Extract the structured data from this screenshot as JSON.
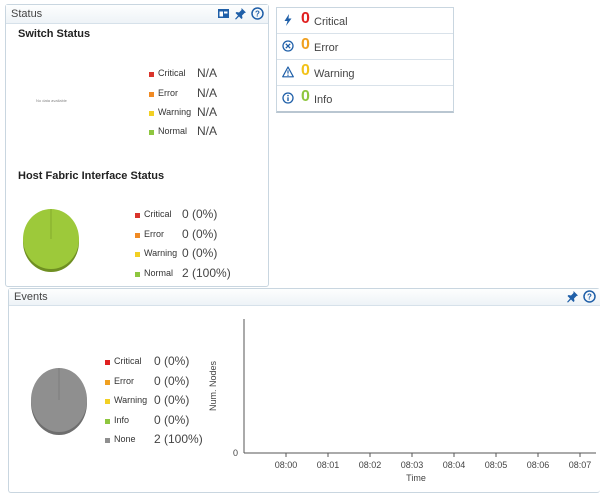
{
  "status_panel": {
    "title": "Status",
    "icons": [
      "layout-icon",
      "pin-icon",
      "help-icon"
    ],
    "switch_status": {
      "title": "Switch Status",
      "no_data_note": "No data available",
      "legend": [
        {
          "label": "Critical",
          "value": "N/A",
          "color": "#d9342b"
        },
        {
          "label": "Error",
          "value": "N/A",
          "color": "#f08a24"
        },
        {
          "label": "Warning",
          "value": "N/A",
          "color": "#f2d024"
        },
        {
          "label": "Normal",
          "value": "N/A",
          "color": "#8ec63f"
        }
      ]
    },
    "hfi_status": {
      "title": "Host Fabric Interface Status",
      "legend": [
        {
          "label": "Critical",
          "value": "0 (0%)",
          "color": "#d9342b"
        },
        {
          "label": "Error",
          "value": "0 (0%)",
          "color": "#f08a24"
        },
        {
          "label": "Warning",
          "value": "0 (0%)",
          "color": "#f2d024"
        },
        {
          "label": "Normal",
          "value": "2 (100%)",
          "color": "#8ec63f"
        }
      ],
      "pie_color": "#9dc93a"
    }
  },
  "summary": [
    {
      "icon": "lightning-icon",
      "count": "0",
      "label": "Critical",
      "count_color": "#e02020"
    },
    {
      "icon": "circle-x-icon",
      "count": "0",
      "label": "Error",
      "count_color": "#f0a020"
    },
    {
      "icon": "warning-triangle-icon",
      "count": "0",
      "label": "Warning",
      "count_color": "#f2c21a"
    },
    {
      "icon": "info-circle-icon",
      "count": "0",
      "label": "Info",
      "count_color": "#8ec63f"
    }
  ],
  "events_panel": {
    "title": "Events",
    "icons": [
      "pin-icon",
      "help-icon"
    ],
    "legend": [
      {
        "label": "Critical",
        "value": "0 (0%)",
        "color": "#e02020"
      },
      {
        "label": "Error",
        "value": "0 (0%)",
        "color": "#f0a020"
      },
      {
        "label": "Warning",
        "value": "0 (0%)",
        "color": "#f2d024"
      },
      {
        "label": "Info",
        "value": "0 (0%)",
        "color": "#8ec63f"
      },
      {
        "label": "None",
        "value": "2 (100%)",
        "color": "#8f8f8f"
      }
    ],
    "pie_color": "#8f8f8f"
  },
  "chart_data": {
    "type": "line",
    "x": [
      "08:00",
      "08:01",
      "08:02",
      "08:03",
      "08:04",
      "08:05",
      "08:06",
      "08:07"
    ],
    "series": [],
    "xlabel": "Time",
    "ylabel": "Num. Nodes",
    "y_ticks": [
      "0"
    ],
    "ylim": [
      0,
      1
    ]
  }
}
